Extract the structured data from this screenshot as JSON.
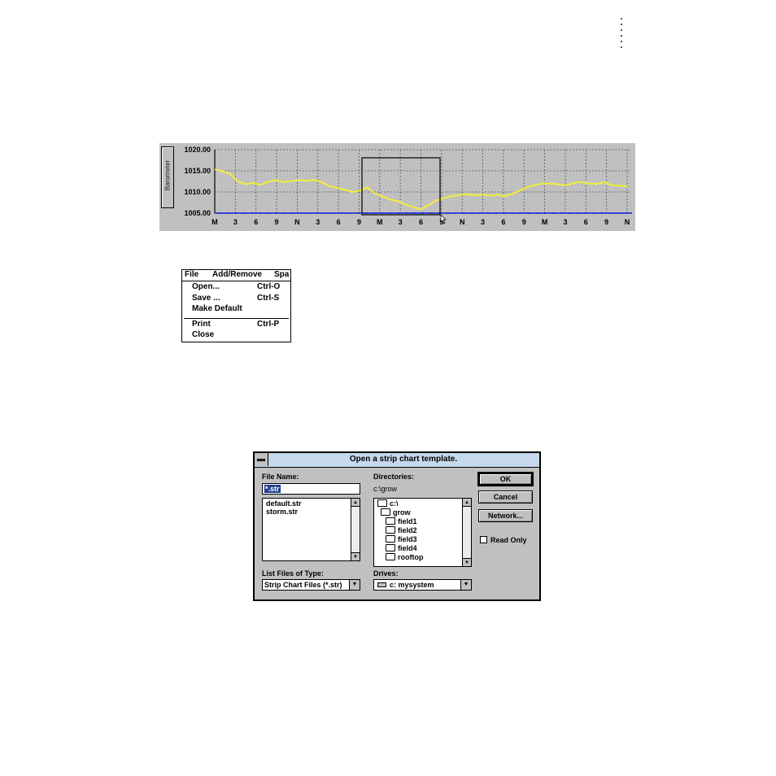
{
  "strip_chart": {
    "ylabel": "Barometer",
    "chart_data": {
      "type": "line",
      "ylabel": "Barometer",
      "ylim": [
        1005.0,
        1020.0
      ],
      "ytick_labels": [
        "1020.00",
        "1015.00",
        "1010.00",
        "1005.00"
      ],
      "xtick_labels": [
        "M",
        "3",
        "6",
        "9",
        "N",
        "3",
        "6",
        "9",
        "M",
        "3",
        "6",
        "9",
        "N",
        "3",
        "6",
        "9",
        "M",
        "3",
        "6",
        "9",
        "N"
      ],
      "grid": true,
      "series": [
        {
          "color": "#f2ee3a",
          "values": [
            1015.3,
            1014.9,
            1014.3,
            1012.6,
            1011.8,
            1012.2,
            1011.7,
            1012.4,
            1012.8,
            1012.3,
            1012.6,
            1012.8,
            1012.6,
            1012.9,
            1012.3,
            1011.4,
            1011.0,
            1010.5,
            1010.0,
            1010.3,
            1011.1,
            1009.6,
            1008.9,
            1008.2,
            1007.8,
            1007.0,
            1006.4,
            1005.9,
            1006.9,
            1008.0,
            1008.5,
            1009.0,
            1009.3,
            1009.5,
            1009.2,
            1009.4,
            1009.1,
            1009.3,
            1009.0,
            1009.6,
            1010.4,
            1011.2,
            1011.7,
            1012.0,
            1012.0,
            1011.8,
            1011.6,
            1012.1,
            1012.4,
            1012.0,
            1011.9,
            1012.3,
            1011.6,
            1011.5,
            1011.3
          ]
        }
      ],
      "baseline": {
        "color": "#3a46d8",
        "value": 1005.0
      }
    }
  },
  "file_menu": {
    "bar": {
      "file": "File",
      "add_remove": "Add/Remove",
      "spa": "Spa"
    },
    "items": {
      "open": "Open...",
      "open_shortcut": "Ctrl-O",
      "save": "Save ...",
      "save_shortcut": "Ctrl-S",
      "make_default": "Make Default",
      "print": "Print",
      "print_shortcut": "Ctrl-P",
      "close": "Close"
    }
  },
  "dialog": {
    "title": "Open a strip chart template.",
    "file_name_label": "File Name:",
    "file_name_value": "*.str",
    "files": [
      "default.str",
      "storm.str"
    ],
    "directories_label": "Directories:",
    "current_dir": "c:\\grow",
    "dirs": [
      "c:\\",
      "grow",
      "field1",
      "field2",
      "field3",
      "field4",
      "rooftop"
    ],
    "list_type_label": "List Files of Type:",
    "list_type_value": "Strip Chart Files (*.str)",
    "drives_label": "Drives:",
    "drive_value": "c: mysystem",
    "ok_label": "OK",
    "cancel_label": "Cancel",
    "network_label": "Network...",
    "read_only_label": "Read Only"
  }
}
